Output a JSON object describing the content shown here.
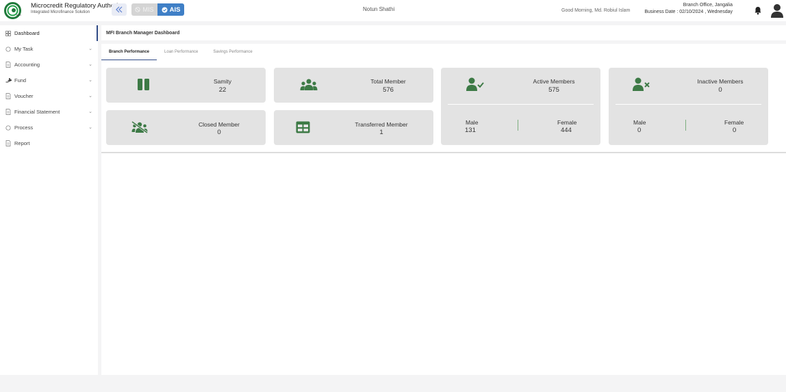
{
  "header": {
    "org_name": "Microcredit Regulatory Authority",
    "org_sub": "Integrated Microfinance Solution",
    "mis_label": "MIS",
    "ais_label": "AIS",
    "center_title": "Notun Shathi",
    "greeting": "Good Morning, Md. Robiul Islam",
    "branch_office": "Branch Office, Jangalia",
    "business_date": "Business Date : 02/10/2024 , Wednesday"
  },
  "sidebar": {
    "items": [
      {
        "label": "Dashboard",
        "icon": "grid-icon",
        "active": true
      },
      {
        "label": "My Task",
        "icon": "circle-icon"
      },
      {
        "label": "Accounting",
        "icon": "document-icon"
      },
      {
        "label": "Fund",
        "icon": "hand-money-icon"
      },
      {
        "label": "Voucher",
        "icon": "document-icon"
      },
      {
        "label": "Financial Statement",
        "icon": "document-icon"
      },
      {
        "label": "Process",
        "icon": "circle-icon"
      },
      {
        "label": "Report",
        "icon": "document-icon"
      }
    ]
  },
  "main": {
    "title": "MFI Branch Manager Dashboard",
    "tabs": [
      "Branch Performance",
      "Loan Performance",
      "Savings Performance"
    ]
  },
  "cards": {
    "samity": {
      "label": "Samity",
      "value": "22"
    },
    "total_member": {
      "label": "Total Member",
      "value": "576"
    },
    "closed_member": {
      "label": "Closed Member",
      "value": "0"
    },
    "transferred_member": {
      "label": "Transferred Member",
      "value": "1"
    },
    "active_members": {
      "label": "Active Members",
      "value": "575",
      "male_label": "Male",
      "male_value": "131",
      "female_label": "Female",
      "female_value": "444"
    },
    "inactive_members": {
      "label": "Inactive Members",
      "value": "0",
      "male_label": "Male",
      "male_value": "0",
      "female_label": "Female",
      "female_value": "0"
    }
  },
  "colors": {
    "accent": "#3f7fc6",
    "icon_green": "#3d7a46",
    "nav_active": "#2f4a86"
  }
}
